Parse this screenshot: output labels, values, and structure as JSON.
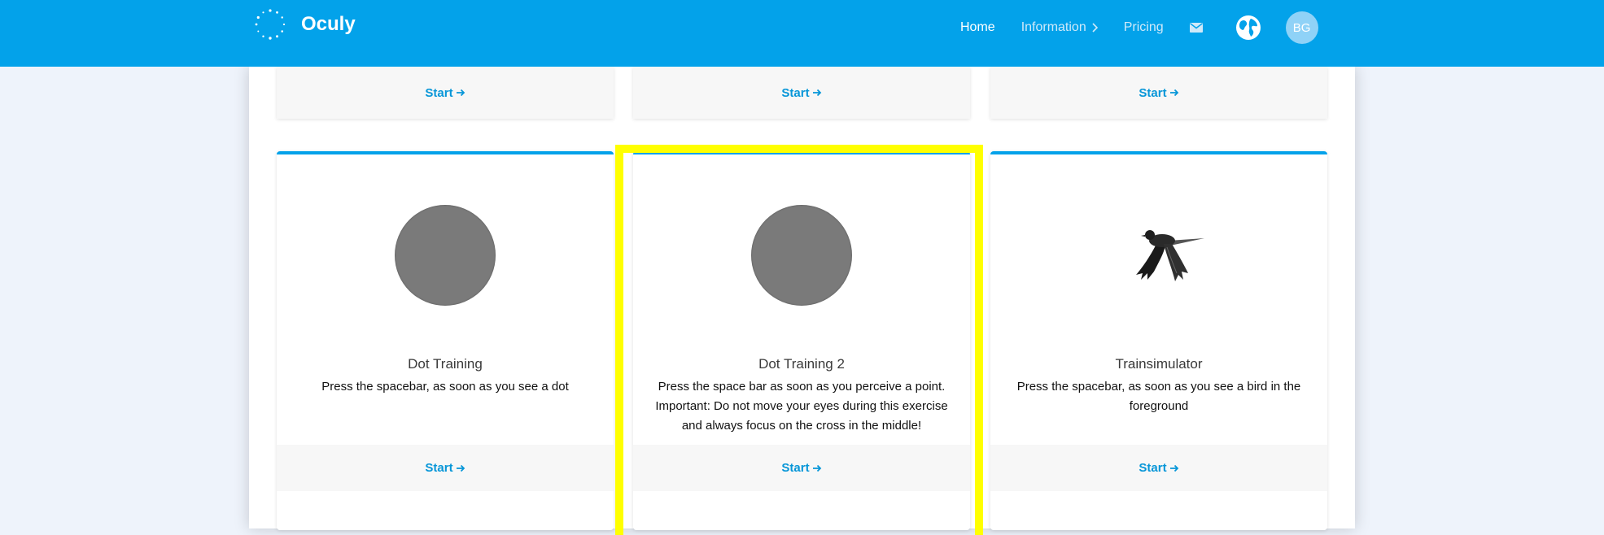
{
  "brand": {
    "name": "Oculy"
  },
  "nav": {
    "home": "Home",
    "information": "Information",
    "pricing": "Pricing",
    "avatar_initials": "BG"
  },
  "colors": {
    "primary": "#03a2ea",
    "highlight": "#ffff00",
    "dot": "#7a7a7a"
  },
  "top_row": [
    {
      "start_label": "Start"
    },
    {
      "start_label": "Start"
    },
    {
      "start_label": "Start"
    }
  ],
  "cards": [
    {
      "title": "Dot Training",
      "description": "Press the spacebar, as soon as you see a dot",
      "start_label": "Start",
      "media": "dot"
    },
    {
      "title": "Dot Training 2",
      "description": "Press the space bar as soon as you perceive a point. Important: Do not move your eyes during this exercise and always focus on the cross in the middle!",
      "start_label": "Start",
      "media": "dot"
    },
    {
      "title": "Trainsimulator",
      "description": "Press the spacebar, as soon as you see a bird in the foreground",
      "start_label": "Start",
      "media": "bird-icon"
    }
  ]
}
